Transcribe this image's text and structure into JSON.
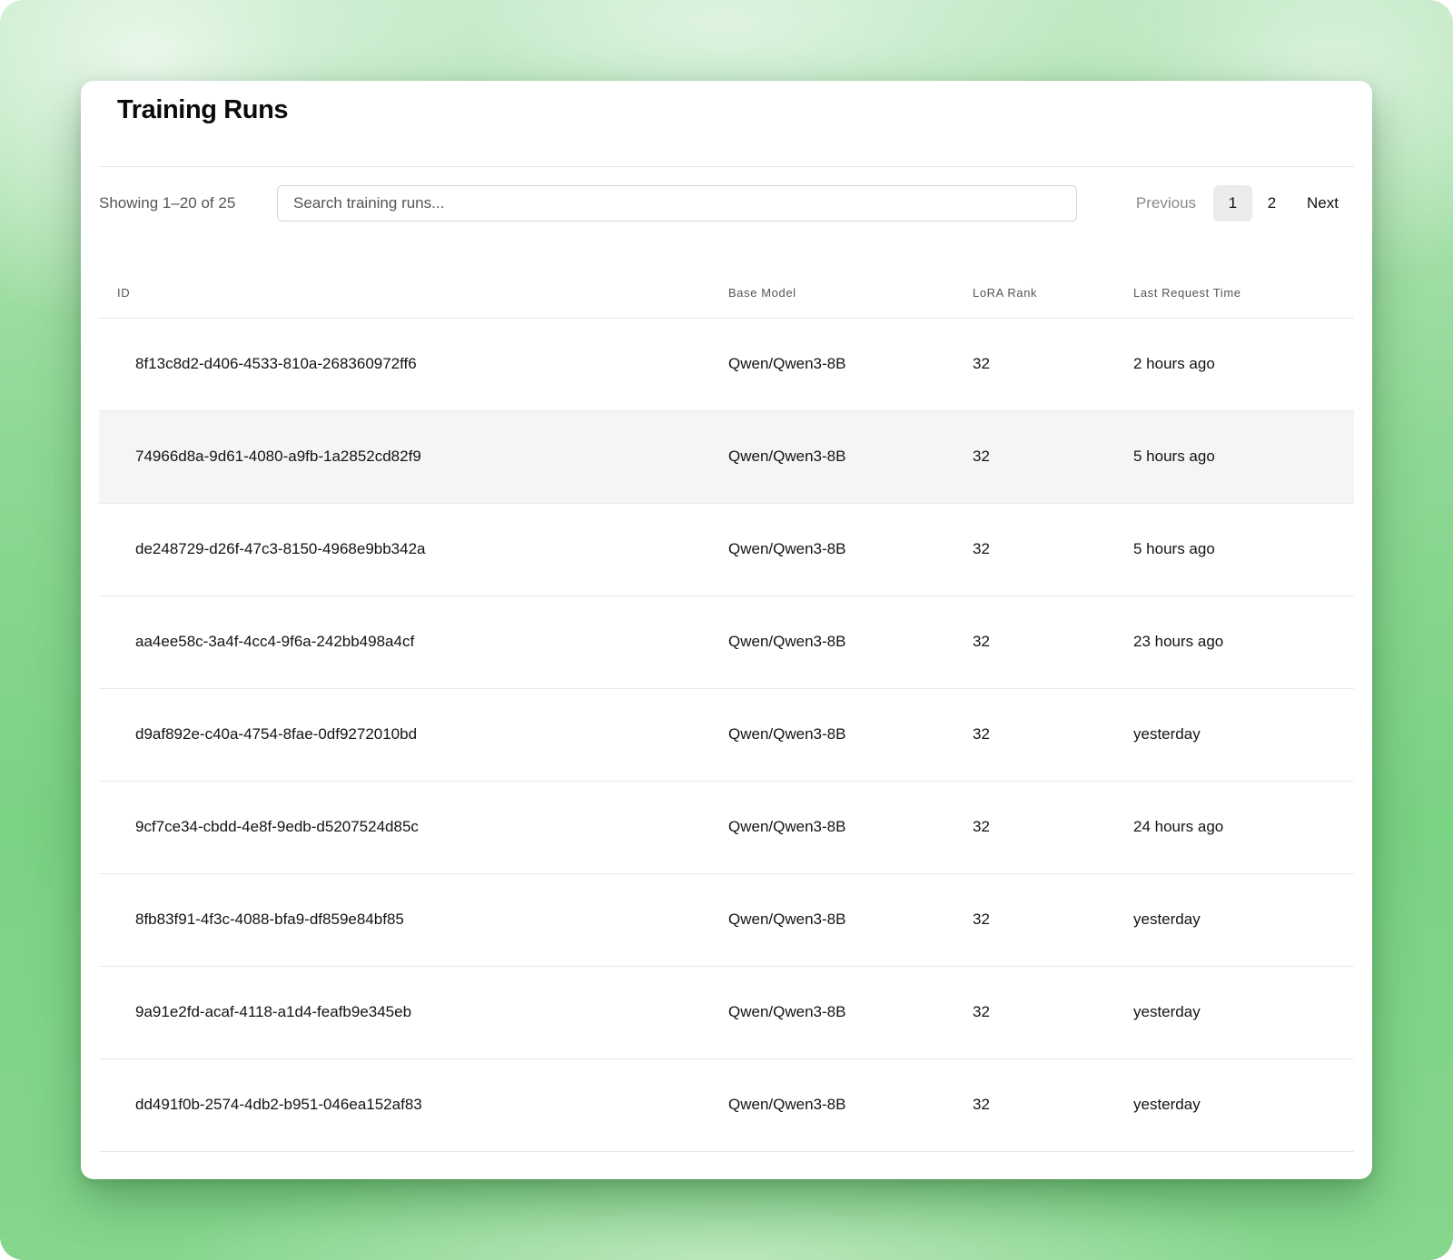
{
  "page": {
    "title": "Training Runs"
  },
  "toolbar": {
    "showing_text": "Showing 1–20 of 25",
    "search_placeholder": "Search training runs...",
    "search_value": ""
  },
  "pagination": {
    "previous_label": "Previous",
    "pages": [
      "1",
      "2"
    ],
    "current_page": "1",
    "next_label": "Next"
  },
  "table": {
    "columns": [
      "ID",
      "Base Model",
      "LoRA Rank",
      "Last Request Time"
    ],
    "rows": [
      {
        "id": "8f13c8d2-d406-4533-810a-268360972ff6",
        "base_model": "Qwen/Qwen3-8B",
        "lora_rank": "32",
        "last_request": "2 hours ago"
      },
      {
        "id": "74966d8a-9d61-4080-a9fb-1a2852cd82f9",
        "base_model": "Qwen/Qwen3-8B",
        "lora_rank": "32",
        "last_request": "5 hours ago"
      },
      {
        "id": "de248729-d26f-47c3-8150-4968e9bb342a",
        "base_model": "Qwen/Qwen3-8B",
        "lora_rank": "32",
        "last_request": "5 hours ago"
      },
      {
        "id": "aa4ee58c-3a4f-4cc4-9f6a-242bb498a4cf",
        "base_model": "Qwen/Qwen3-8B",
        "lora_rank": "32",
        "last_request": "23 hours ago"
      },
      {
        "id": "d9af892e-c40a-4754-8fae-0df9272010bd",
        "base_model": "Qwen/Qwen3-8B",
        "lora_rank": "32",
        "last_request": "yesterday"
      },
      {
        "id": "9cf7ce34-cbdd-4e8f-9edb-d5207524d85c",
        "base_model": "Qwen/Qwen3-8B",
        "lora_rank": "32",
        "last_request": "24 hours ago"
      },
      {
        "id": "8fb83f91-4f3c-4088-bfa9-df859e84bf85",
        "base_model": "Qwen/Qwen3-8B",
        "lora_rank": "32",
        "last_request": "yesterday"
      },
      {
        "id": "9a91e2fd-acaf-4118-a1d4-feafb9e345eb",
        "base_model": "Qwen/Qwen3-8B",
        "lora_rank": "32",
        "last_request": "yesterday"
      },
      {
        "id": "dd491f0b-2574-4db2-b951-046ea152af83",
        "base_model": "Qwen/Qwen3-8B",
        "lora_rank": "32",
        "last_request": "yesterday"
      }
    ],
    "hovered_row": "74966d8a-9d61-4080-a9fb-1a2852cd82f9"
  }
}
